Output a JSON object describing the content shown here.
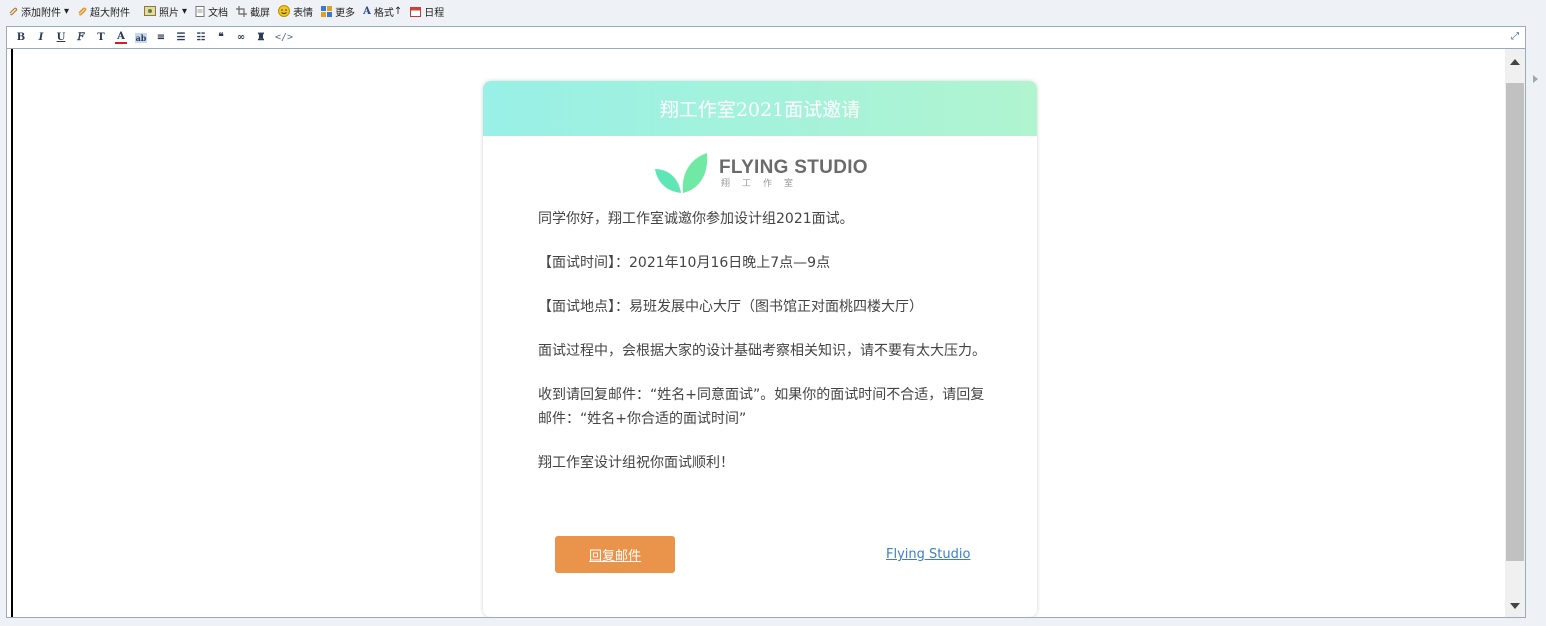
{
  "toolbar": {
    "add_attachment": "添加附件",
    "big_attachment": "超大附件",
    "photo": "照片",
    "document": "文档",
    "screenshot": "截屏",
    "emoji": "表情",
    "more": "更多",
    "format": "格式",
    "calendar": "日程"
  },
  "format_bar": {
    "bold": "B",
    "italic": "I",
    "underline": "U",
    "code": "</>"
  },
  "email": {
    "header_title": "翔工作室2021面试邀请",
    "logo_en": "FLYING STUDIO",
    "logo_cn": "翔工作室",
    "paragraphs": [
      "同学你好，翔工作室诚邀你参加设计组2021面试。",
      "【面试时间】：2021年10月16日晚上7点—9点",
      "【面试地点】：易班发展中心大厅（图书馆正对面桃四楼大厅）",
      "面试过程中，会根据大家的设计基础考察相关知识，请不要有太大压力。",
      "收到请回复邮件：“姓名+同意面试”。如果你的面试时间不合适，请回复邮件：“姓名+你合适的面试时间”",
      "翔工作室设计组祝你面试顺利！"
    ],
    "reply_button": "回复邮件",
    "studio_link": "Flying Studio"
  },
  "colors": {
    "header_gradient_start": "#98f0e6",
    "header_gradient_end": "#b0f4d0",
    "button": "#e9944a",
    "link": "#3d7fc4",
    "logo_leaf": "#5fe6b6"
  }
}
